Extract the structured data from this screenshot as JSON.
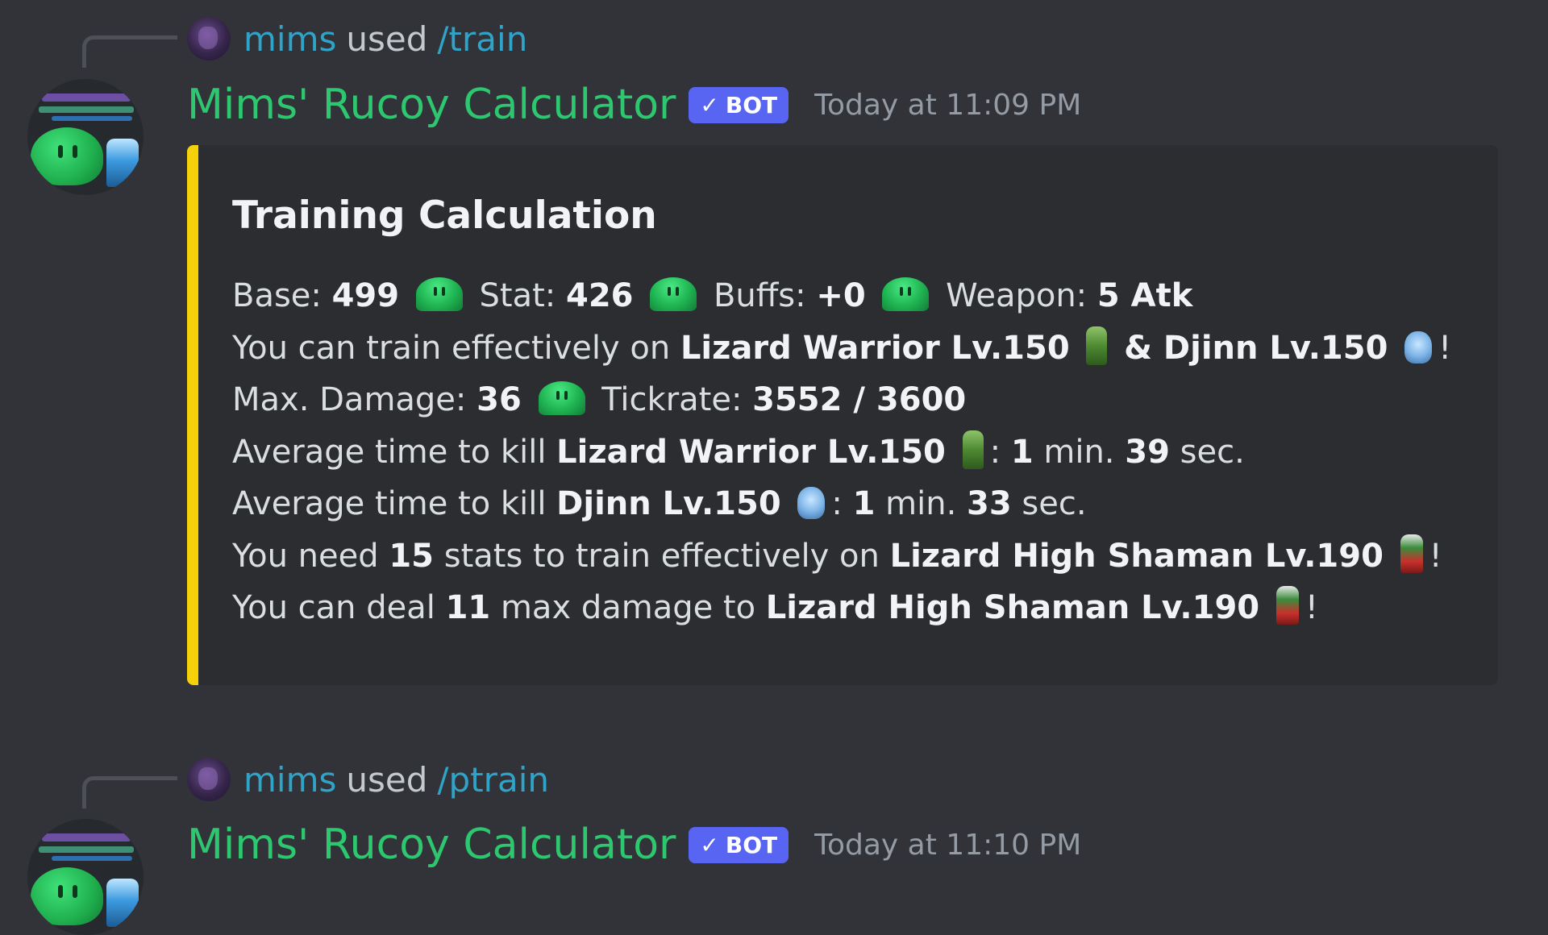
{
  "messages": [
    {
      "reply": {
        "user": "mims",
        "used": "used",
        "command": "/train"
      },
      "author": "Mims' Rucoy Calculator",
      "bot_tag": "BOT",
      "bot_check": "✓",
      "timestamp": "Today at 11:09 PM",
      "embed": {
        "accent_color": "#f5d10c",
        "title": "Training Calculation",
        "line1": {
          "base_label": "Base: ",
          "base": "499",
          "stat_label": " Stat: ",
          "stat": "426",
          "buffs_label": " Buffs: ",
          "buffs": "+0",
          "weapon_label": " Weapon: ",
          "weapon": "5 Atk"
        },
        "line2": {
          "prefix": "You can train effectively on ",
          "mob1": "Lizard Warrior Lv.150",
          "amp": " & ",
          "mob2": "Djinn Lv.150",
          "suffix": "!"
        },
        "line3": {
          "label": "Max. Damage: ",
          "value": "36",
          "tick_label": " Tickrate: ",
          "tick": "3552 / 3600"
        },
        "line4": {
          "prefix": "Average time to kill ",
          "mob": "Lizard Warrior Lv.150",
          "colon": ": ",
          "min": "1",
          "min_label": " min. ",
          "sec": "39",
          "sec_label": " sec."
        },
        "line5": {
          "prefix": "Average time to kill ",
          "mob": "Djinn Lv.150",
          "colon": ": ",
          "min": "1",
          "min_label": " min. ",
          "sec": "33",
          "sec_label": " sec."
        },
        "line6": {
          "prefix": "You need ",
          "stats": "15",
          "middle": " stats to train effectively on ",
          "mob": "Lizard High Shaman Lv.190",
          "suffix": "!"
        },
        "line7": {
          "prefix": "You can deal ",
          "dmg": "11",
          "middle": " max damage to ",
          "mob": "Lizard High Shaman Lv.190",
          "suffix": "!"
        }
      }
    },
    {
      "reply": {
        "user": "mims",
        "used": "used",
        "command": "/ptrain"
      },
      "author": "Mims' Rucoy Calculator",
      "bot_tag": "BOT",
      "bot_check": "✓",
      "timestamp": "Today at 11:10 PM"
    }
  ],
  "icons": {
    "stat_emoji": "green-slime-icon",
    "lizard_warrior": "lizard-warrior-icon",
    "djinn": "djinn-icon",
    "shaman": "lizard-high-shaman-icon"
  },
  "colors": {
    "background": "#313338",
    "embed_bg": "#2b2d31",
    "author": "#2dc770",
    "mention": "#2fa3c8",
    "bot_tag": "#5865f2"
  }
}
